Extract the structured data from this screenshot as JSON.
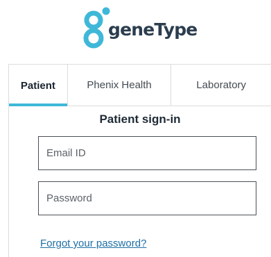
{
  "logo": {
    "text": "geneType"
  },
  "tabs": [
    {
      "label": "Patient",
      "active": true
    },
    {
      "label": "Phenix Health",
      "active": false
    },
    {
      "label": "Laboratory",
      "active": false
    }
  ],
  "form": {
    "heading": "Patient sign-in",
    "email_placeholder": "Email ID",
    "email_value": "",
    "password_placeholder": "Password",
    "password_value": "",
    "forgot_label": "Forgot your password?"
  },
  "colors": {
    "accent": "#3fb8d8",
    "link": "#1d6fa5",
    "text": "#1f2a36"
  }
}
